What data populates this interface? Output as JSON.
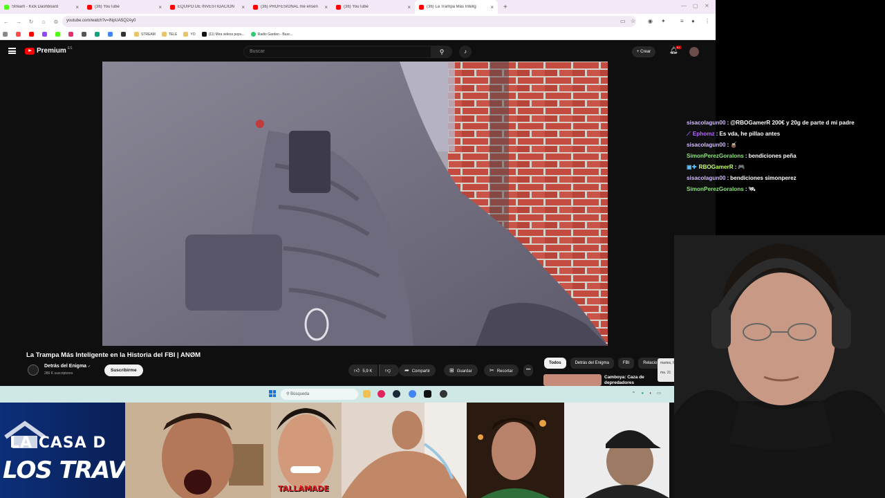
{
  "browser": {
    "tabs": [
      {
        "label": "Stream - Kick Dashboard",
        "favicon_color": "#53fc18"
      },
      {
        "label": "(36) YouTube",
        "favicon_color": "#ff0000"
      },
      {
        "label": "EQUIPO DE INVESTIGACIÓN",
        "favicon_color": "#ff0000"
      },
      {
        "label": "(36) PROFESIONAL me enseñ",
        "favicon_color": "#ff0000"
      },
      {
        "label": "(36) YouTube",
        "favicon_color": "#ff0000"
      },
      {
        "label": "(36) La Trampa Más Intelig",
        "favicon_color": "#ff0000",
        "active": true
      }
    ],
    "tab_close": "×",
    "tab_add": "+",
    "url": "youtube.com/watch?v=lNpUA5Q2Ay0",
    "bookmarks": [
      "STREAM",
      "TELE",
      "YO",
      "(11) Mira videos popu...",
      "Radio Garden - Busc..."
    ]
  },
  "youtube": {
    "logo_text": "Premium",
    "logo_sup": "ES",
    "search_placeholder": "Buscar",
    "create_label": "Crear",
    "notif_badge": "9+",
    "video_title": "La Trampa Más Inteligente en la Historia del FBI | ANØM",
    "channel_name": "Detrás del Enigma",
    "channel_verified": "✓",
    "subscribers": "280 K suscriptores",
    "subscribe_label": "Suscribirme",
    "actions": {
      "likes": "5,9 K",
      "share": "Compartir",
      "save": "Guardar",
      "clip": "Recortar",
      "more": "•••"
    },
    "chips": [
      "Todos",
      "Detrás del Enigma",
      "FBI",
      "Relacio"
    ],
    "recommendation_title": "Camboya: Caza de depredadores",
    "tooltip_lines": [
      "martes, 6",
      "ma. 21"
    ]
  },
  "taskbar": {
    "search_placeholder": "Búsqueda",
    "tray_chevron": "^"
  },
  "chat": [
    {
      "user": "sisacolagun00",
      "color": "#d2bbff",
      "text": "@RBOGamerR 200€ y 20g de parte d mi padre"
    },
    {
      "user": "Ephomz",
      "color": "#b565ff",
      "prefix": "⟋",
      "text": "Es vda, he pillao antes"
    },
    {
      "user": "sisacolagun00",
      "color": "#d2bbff",
      "text": "🧉"
    },
    {
      "user": "SimonPerezGoralons",
      "color": "#8fe37d",
      "text": "bendiciones peña"
    },
    {
      "user": "RBOGamerR",
      "color": "#c6ff66",
      "prefix": "▣✚",
      "text": "🎮"
    },
    {
      "user": "sisacolagun00",
      "color": "#d2bbff",
      "text": "bendiciones simonperez"
    },
    {
      "user": "SimonPerezGoralons",
      "color": "#8fe37d",
      "text": "🛰"
    }
  ],
  "overlay": {
    "casa_line1": "LA CASA D",
    "casa_line2": "LOS TRAVELO",
    "tallamade": "TALLAMADE"
  }
}
